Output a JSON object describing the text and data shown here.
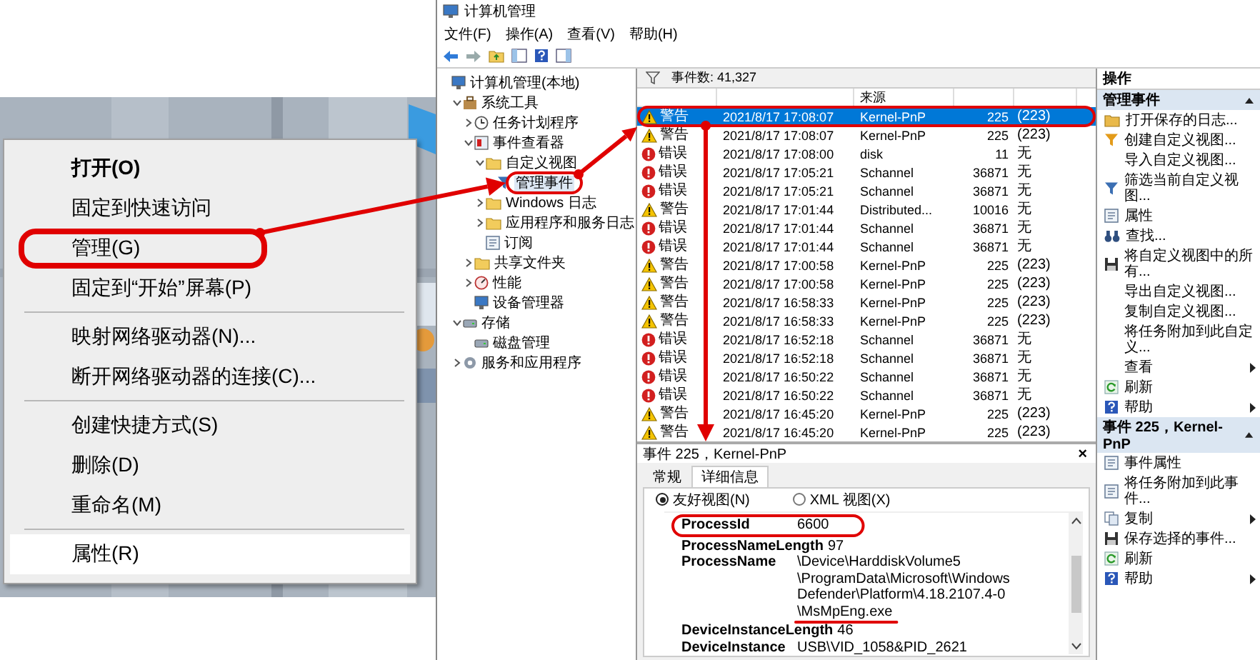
{
  "context_menu": {
    "groups": [
      [
        {
          "label": "打开(O)",
          "bold": true,
          "selected": false,
          "circled": false
        },
        {
          "label": "固定到快速访问",
          "bold": false,
          "selected": false,
          "circled": false
        },
        {
          "label": "管理(G)",
          "bold": false,
          "selected": false,
          "circled": true
        },
        {
          "label": "固定到“开始”屏幕(P)",
          "bold": false,
          "selected": false,
          "circled": false
        }
      ],
      [
        {
          "label": "映射网络驱动器(N)...",
          "bold": false,
          "selected": false,
          "circled": false
        },
        {
          "label": "断开网络驱动器的连接(C)...",
          "bold": false,
          "selected": false,
          "circled": false
        }
      ],
      [
        {
          "label": "创建快捷方式(S)",
          "bold": false,
          "selected": false,
          "circled": false
        },
        {
          "label": "删除(D)",
          "bold": false,
          "selected": false,
          "circled": false
        },
        {
          "label": "重命名(M)",
          "bold": false,
          "selected": false,
          "circled": false
        }
      ],
      [
        {
          "label": "属性(R)",
          "bold": false,
          "selected": true,
          "circled": false
        }
      ]
    ]
  },
  "window": {
    "title": "计算机管理",
    "menu": [
      "文件(F)",
      "操作(A)",
      "查看(V)",
      "帮助(H)"
    ]
  },
  "tree": [
    {
      "label": "计算机管理(本地)",
      "kind": "computer",
      "selected": false,
      "circled": false,
      "children": [
        {
          "label": "系统工具",
          "kind": "tools",
          "selected": false,
          "circled": false,
          "expanded": true,
          "children": [
            {
              "label": "任务计划程序",
              "kind": "scheduler",
              "selected": false,
              "circled": false,
              "expanded": false
            },
            {
              "label": "事件查看器",
              "kind": "viewer",
              "selected": false,
              "circled": false,
              "expanded": true,
              "children": [
                {
                  "label": "自定义视图",
                  "kind": "folder",
                  "selected": false,
                  "circled": false,
                  "expanded": true,
                  "children": [
                    {
                      "label": "管理事件",
                      "kind": "view",
                      "selected": true,
                      "circled": true
                    }
                  ]
                },
                {
                  "label": "Windows 日志",
                  "kind": "folder",
                  "selected": false,
                  "circled": false,
                  "expanded": false
                },
                {
                  "label": "应用程序和服务日志",
                  "kind": "folder",
                  "selected": false,
                  "circled": false,
                  "expanded": false
                },
                {
                  "label": "订阅",
                  "kind": "subscription",
                  "selected": false,
                  "circled": false
                }
              ]
            },
            {
              "label": "共享文件夹",
              "kind": "share",
              "selected": false,
              "circled": false,
              "expanded": false
            },
            {
              "label": "性能",
              "kind": "performance",
              "selected": false,
              "circled": false,
              "expanded": false
            },
            {
              "label": "设备管理器",
              "kind": "devices",
              "selected": false,
              "circled": false
            }
          ]
        },
        {
          "label": "存储",
          "kind": "storage",
          "selected": false,
          "circled": false,
          "expanded": true,
          "children": [
            {
              "label": "磁盘管理",
              "kind": "disk",
              "selected": false,
              "circled": false
            }
          ]
        },
        {
          "label": "服务和应用程序",
          "kind": "services",
          "selected": false,
          "circled": false,
          "expanded": false
        }
      ]
    }
  ],
  "events": {
    "count": "事件数: 41,327",
    "source_column": "来源",
    "rows": [
      {
        "kind": "warning",
        "level": "警告",
        "date": "2021/8/17 17:08:07",
        "source": "Kernel-PnP",
        "event_id": "225",
        "task": "(223)",
        "selected": true,
        "circled": true
      },
      {
        "kind": "warning",
        "level": "警告",
        "date": "2021/8/17 17:08:07",
        "source": "Kernel-PnP",
        "event_id": "225",
        "task": "(223)",
        "selected": false,
        "circled": false
      },
      {
        "kind": "error",
        "level": "错误",
        "date": "2021/8/17 17:08:00",
        "source": "disk",
        "event_id": "11",
        "task": "无",
        "selected": false,
        "circled": false
      },
      {
        "kind": "error",
        "level": "错误",
        "date": "2021/8/17 17:05:21",
        "source": "Schannel",
        "event_id": "36871",
        "task": "无",
        "selected": false,
        "circled": false
      },
      {
        "kind": "error",
        "level": "错误",
        "date": "2021/8/17 17:05:21",
        "source": "Schannel",
        "event_id": "36871",
        "task": "无",
        "selected": false,
        "circled": false
      },
      {
        "kind": "warning",
        "level": "警告",
        "date": "2021/8/17 17:01:44",
        "source": "Distributed...",
        "event_id": "10016",
        "task": "无",
        "selected": false,
        "circled": false
      },
      {
        "kind": "error",
        "level": "错误",
        "date": "2021/8/17 17:01:44",
        "source": "Schannel",
        "event_id": "36871",
        "task": "无",
        "selected": false,
        "circled": false
      },
      {
        "kind": "error",
        "level": "错误",
        "date": "2021/8/17 17:01:44",
        "source": "Schannel",
        "event_id": "36871",
        "task": "无",
        "selected": false,
        "circled": false
      },
      {
        "kind": "warning",
        "level": "警告",
        "date": "2021/8/17 17:00:58",
        "source": "Kernel-PnP",
        "event_id": "225",
        "task": "(223)",
        "selected": false,
        "circled": false
      },
      {
        "kind": "warning",
        "level": "警告",
        "date": "2021/8/17 17:00:58",
        "source": "Kernel-PnP",
        "event_id": "225",
        "task": "(223)",
        "selected": false,
        "circled": false
      },
      {
        "kind": "warning",
        "level": "警告",
        "date": "2021/8/17 16:58:33",
        "source": "Kernel-PnP",
        "event_id": "225",
        "task": "(223)",
        "selected": false,
        "circled": false
      },
      {
        "kind": "warning",
        "level": "警告",
        "date": "2021/8/17 16:58:33",
        "source": "Kernel-PnP",
        "event_id": "225",
        "task": "(223)",
        "selected": false,
        "circled": false
      },
      {
        "kind": "error",
        "level": "错误",
        "date": "2021/8/17 16:52:18",
        "source": "Schannel",
        "event_id": "36871",
        "task": "无",
        "selected": false,
        "circled": false
      },
      {
        "kind": "error",
        "level": "错误",
        "date": "2021/8/17 16:52:18",
        "source": "Schannel",
        "event_id": "36871",
        "task": "无",
        "selected": false,
        "circled": false
      },
      {
        "kind": "error",
        "level": "错误",
        "date": "2021/8/17 16:50:22",
        "source": "Schannel",
        "event_id": "36871",
        "task": "无",
        "selected": false,
        "circled": false
      },
      {
        "kind": "error",
        "level": "错误",
        "date": "2021/8/17 16:50:22",
        "source": "Schannel",
        "event_id": "36871",
        "task": "无",
        "selected": false,
        "circled": false
      },
      {
        "kind": "warning",
        "level": "警告",
        "date": "2021/8/17 16:45:20",
        "source": "Kernel-PnP",
        "event_id": "225",
        "task": "(223)",
        "selected": false,
        "circled": false
      },
      {
        "kind": "warning",
        "level": "警告",
        "date": "2021/8/17 16:45:20",
        "source": "Kernel-PnP",
        "event_id": "225",
        "task": "(223)",
        "selected": false,
        "circled": false
      }
    ]
  },
  "detail": {
    "title": "事件 225，Kernel-PnP",
    "close": "×",
    "tabs": [
      {
        "label": "常规",
        "selected": false
      },
      {
        "label": "详细信息",
        "selected": true
      }
    ],
    "views": [
      {
        "label": "友好视图(N)",
        "selected": true
      },
      {
        "label": "XML 视图(X)",
        "selected": false
      }
    ],
    "fields": [
      {
        "name": "ProcessId",
        "circled": true,
        "value": [
          {
            "text": "6600",
            "underlined": false
          }
        ]
      },
      {
        "name": "ProcessNameLength",
        "circled": false,
        "value": [
          {
            "text": "97",
            "underlined": false
          }
        ]
      },
      {
        "name": "ProcessName",
        "circled": false,
        "value": [
          {
            "text": "\\Device\\HarddiskVolume5",
            "underlined": false
          },
          {
            "text": "\\ProgramData\\Microsoft\\Windows",
            "underlined": false
          },
          {
            "text": "Defender\\Platform\\4.18.2107.4-0",
            "underlined": false
          },
          {
            "text": "\\MsMpEng.exe",
            "underlined": true
          }
        ]
      },
      {
        "name": "DeviceInstanceLength",
        "circled": false,
        "value": [
          {
            "text": "46",
            "underlined": false
          }
        ]
      },
      {
        "name": "DeviceInstance",
        "circled": false,
        "value": [
          {
            "text": "USB\\VID_1058&PID_2621",
            "underlined": false
          }
        ]
      }
    ]
  },
  "actions": {
    "title": "操作",
    "sections": [
      {
        "title": "管理事件",
        "expanded": true,
        "items": [
          {
            "label": "打开保存的日志...",
            "kind": "open",
            "submenu": false
          },
          {
            "label": "创建自定义视图...",
            "kind": "create",
            "submenu": false
          },
          {
            "label": "导入自定义视图...",
            "kind": "plain",
            "submenu": false
          },
          {
            "label": "筛选当前自定义视图...",
            "kind": "filter",
            "submenu": false
          },
          {
            "label": "属性",
            "kind": "properties",
            "submenu": false
          },
          {
            "label": "查找...",
            "kind": "find",
            "submenu": false
          },
          {
            "label": "将自定义视图中的所有...",
            "kind": "save",
            "submenu": false
          },
          {
            "label": "导出自定义视图...",
            "kind": "plain",
            "submenu": false
          },
          {
            "label": "复制自定义视图...",
            "kind": "plain",
            "submenu": false
          },
          {
            "label": "将任务附加到此自定义...",
            "kind": "plain",
            "submenu": false
          },
          {
            "label": "查看",
            "kind": "plain",
            "submenu": true
          },
          {
            "label": "刷新",
            "kind": "refresh",
            "submenu": false
          },
          {
            "label": "帮助",
            "kind": "help",
            "submenu": true
          }
        ]
      },
      {
        "title": "事件 225，Kernel-PnP",
        "expanded": true,
        "items": [
          {
            "label": "事件属性",
            "kind": "properties",
            "submenu": false
          },
          {
            "label": "将任务附加到此事件...",
            "kind": "task",
            "submenu": false
          },
          {
            "label": "复制",
            "kind": "copy",
            "submenu": true
          },
          {
            "label": "保存选择的事件...",
            "kind": "save",
            "submenu": false
          },
          {
            "label": "刷新",
            "kind": "refresh",
            "submenu": false
          },
          {
            "label": "帮助",
            "kind": "help",
            "submenu": true
          }
        ]
      }
    ]
  }
}
